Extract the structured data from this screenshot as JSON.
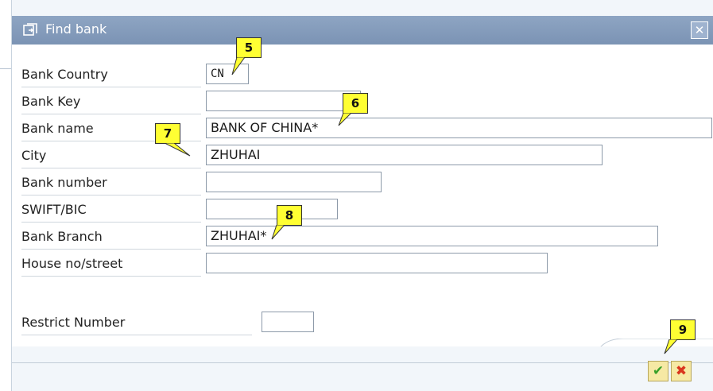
{
  "dialog": {
    "title": "Find bank",
    "close_symbol": "✕"
  },
  "fields": [
    {
      "label": "Bank Country",
      "value": "CN"
    },
    {
      "label": "Bank Key",
      "value": ""
    },
    {
      "label": "Bank name",
      "value": "BANK OF CHINA*"
    },
    {
      "label": "City",
      "value": "ZHUHAI"
    },
    {
      "label": "Bank number",
      "value": ""
    },
    {
      "label": "SWIFT/BIC",
      "value": ""
    },
    {
      "label": "Bank Branch",
      "value": "ZHUHAI*"
    },
    {
      "label": "House no/street",
      "value": ""
    }
  ],
  "restrict": {
    "label": "Restrict Number",
    "value": ""
  },
  "buttons": {
    "ok_symbol": "✔",
    "cancel_symbol": "✖"
  },
  "callouts": [
    "5",
    "6",
    "7",
    "8",
    "9"
  ],
  "icons": {
    "title": "window-restore-icon",
    "close": "close-icon",
    "ok": "checkmark-icon",
    "cancel": "cancel-icon"
  },
  "colors": {
    "titlebar": "#7b93b4",
    "callout": "#ffff33",
    "ok_icon": "#3aa02a",
    "cancel_icon": "#d9361e",
    "button_bg": "#f6e9a4"
  }
}
